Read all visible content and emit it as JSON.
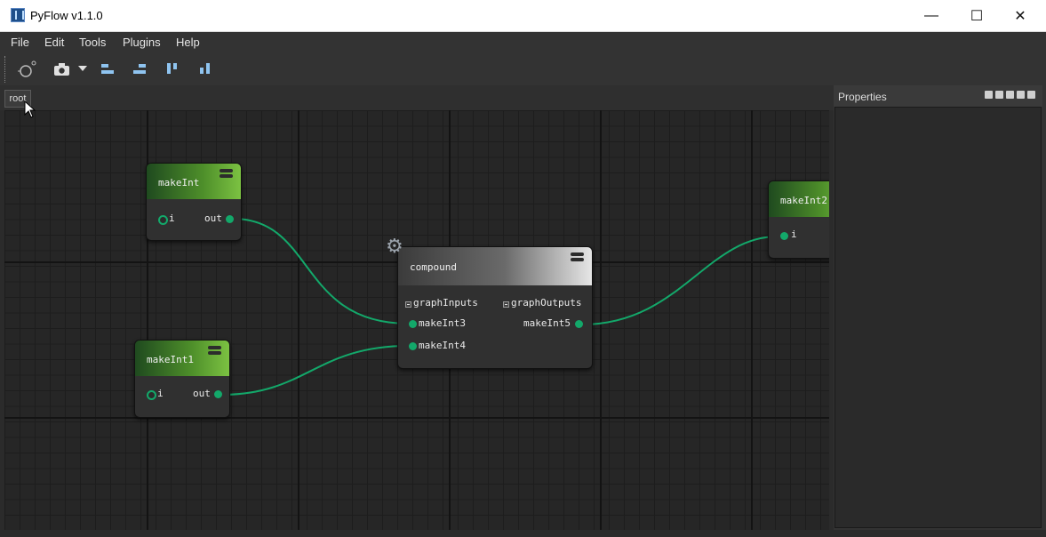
{
  "window": {
    "title": "PyFlow v1.1.0",
    "controls": [
      "—",
      "☐",
      "✕"
    ]
  },
  "menu": [
    "File",
    "Edit",
    "Tools",
    "Plugins",
    "Help"
  ],
  "toolbar": {
    "icons": [
      "new-graph-icon",
      "screenshot-icon",
      "dropdown-arrow-icon",
      "align-left-icon",
      "align-right-icon",
      "align-top-icon",
      "align-bottom-icon"
    ]
  },
  "breadcrumb": {
    "root": "root"
  },
  "nodes": {
    "makeInt": {
      "title": "makeInt",
      "in": "i",
      "out": "out"
    },
    "makeInt1": {
      "title": "makeInt1",
      "in": "i",
      "out": "out"
    },
    "makeInt2": {
      "title": "makeInt2",
      "in": "i"
    },
    "compound": {
      "title": "compound",
      "group_inputs": "graphInputs",
      "group_outputs": "graphOutputs",
      "in1": "makeInt3",
      "in2": "makeInt4",
      "out1": "makeInt5"
    }
  },
  "properties": {
    "title": "Properties"
  },
  "colors": {
    "wire": "#13a86a",
    "node_header_green": "#7cc242",
    "canvas": "#262626"
  }
}
